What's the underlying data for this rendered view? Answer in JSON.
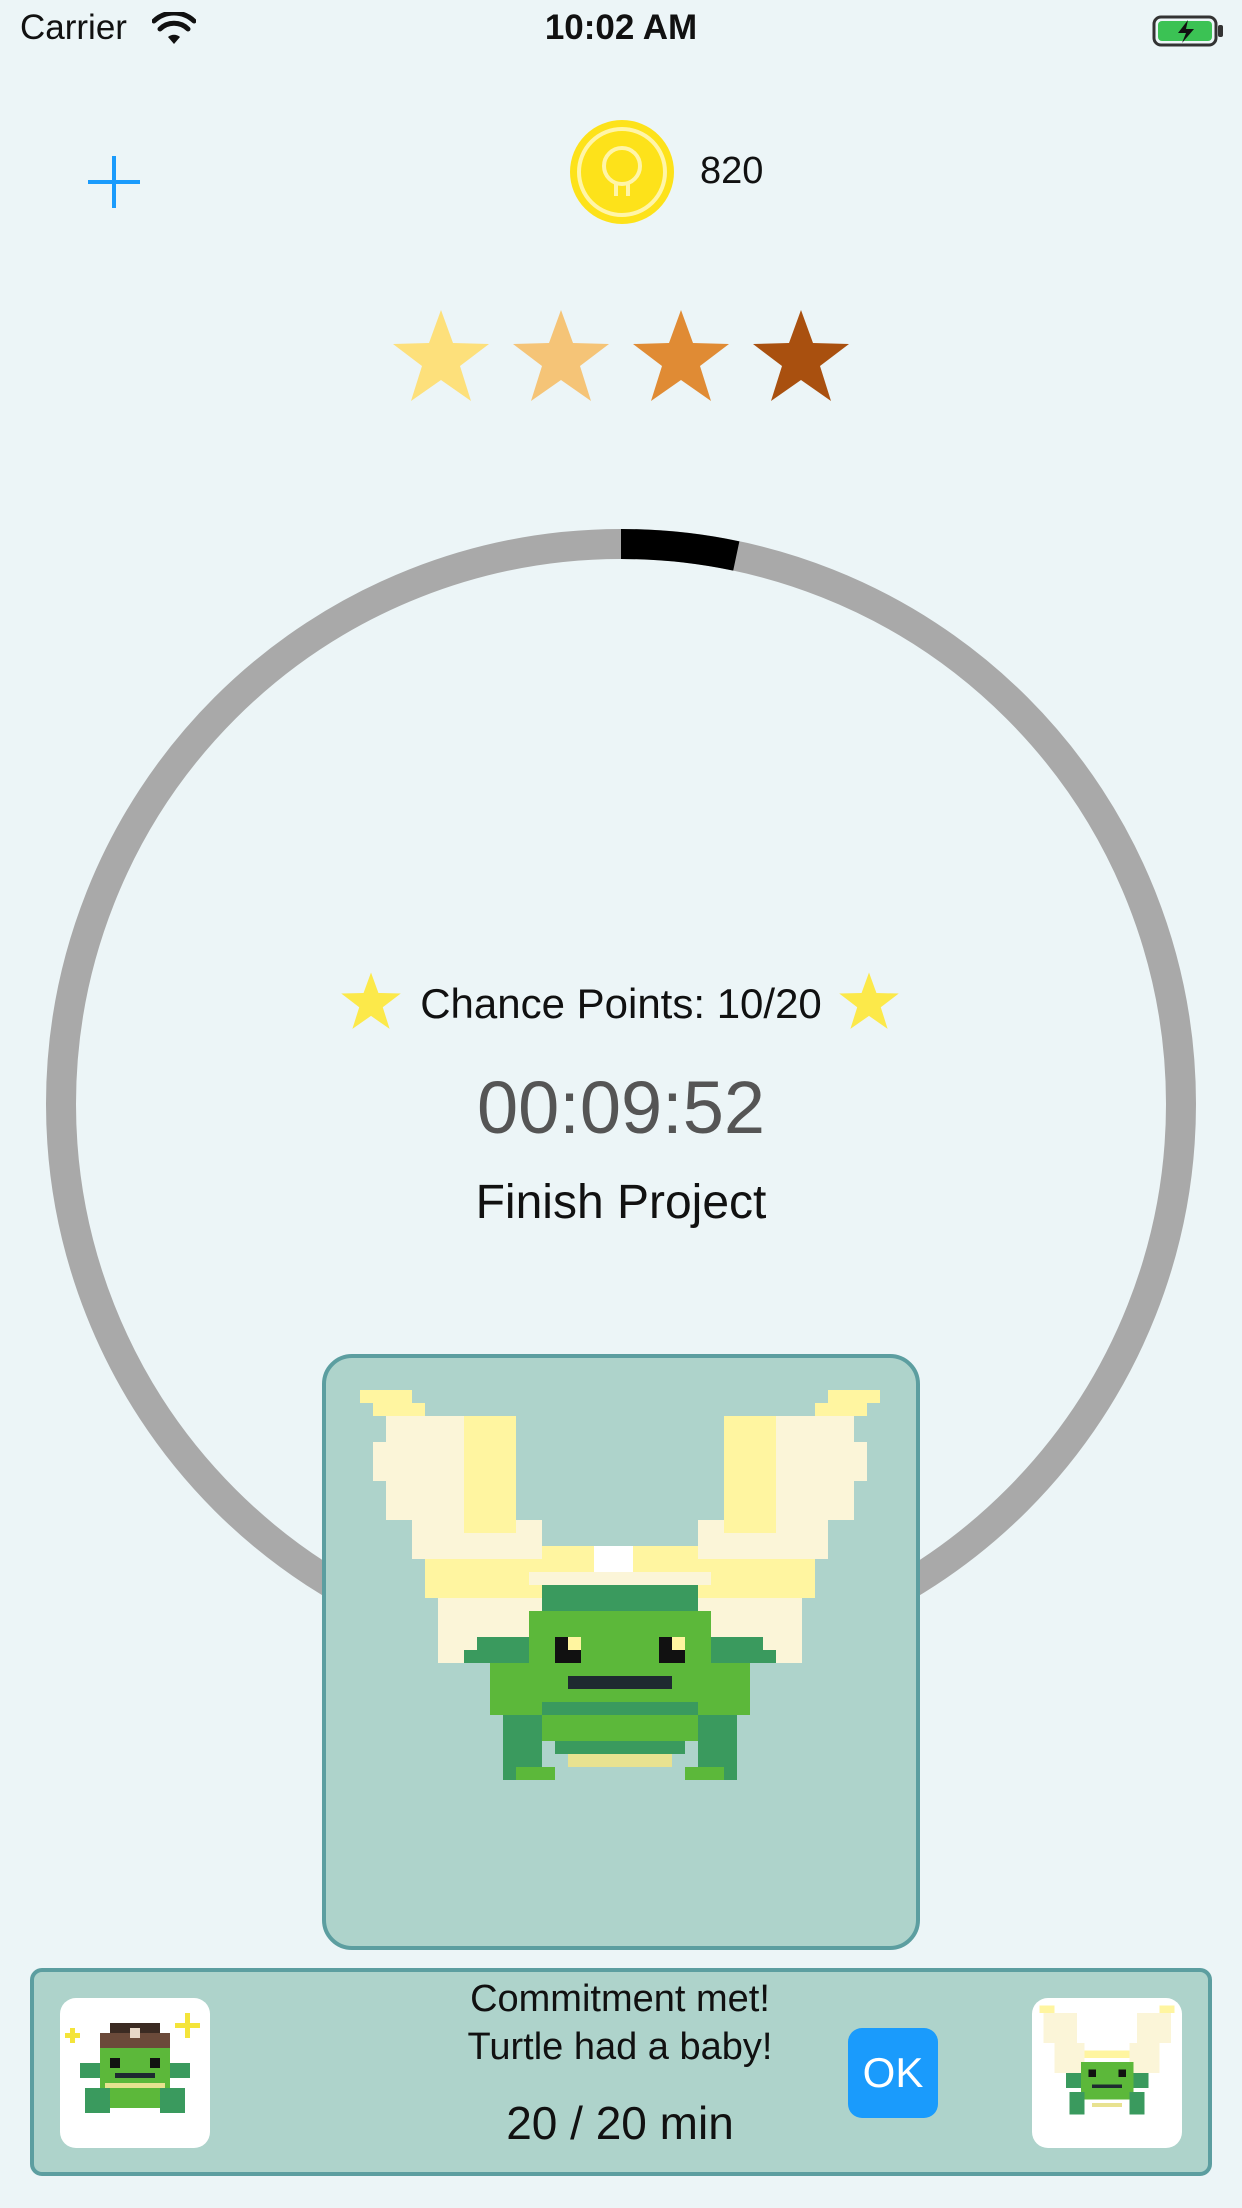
{
  "status_bar": {
    "carrier": "Carrier",
    "time": "10:02 AM"
  },
  "header": {
    "add_icon": "plus-icon",
    "coin_icon": "coin-bulb-icon",
    "coins": "820"
  },
  "stars": [
    {
      "icon": "star-icon",
      "color": "#fde07b"
    },
    {
      "icon": "star-icon",
      "color": "#f5c477"
    },
    {
      "icon": "star-icon",
      "color": "#e08b34"
    },
    {
      "icon": "star-icon",
      "color": "#a9500f"
    }
  ],
  "timer_panel": {
    "chance_points": "Chance Points: 10/20",
    "time_remaining": "00:09:52",
    "task": "Finish Project",
    "progress_fraction": 0.033
  },
  "pet": {
    "name_icon": "winged-turtle-sprite"
  },
  "banner": {
    "line1": "Commitment met!",
    "line2": "Turtle had a baby!",
    "minutes": "20 / 20 min",
    "ok_label": "OK",
    "left_icon": "baby-turtle-icon",
    "right_icon": "winged-turtle-icon"
  },
  "colors": {
    "background": "#ecf5f7",
    "card": "#aed3cb",
    "card_border": "#5c9ea0",
    "accent": "#1a9bfc",
    "ring": "#a9a9a9",
    "ring_progress": "#000000"
  }
}
